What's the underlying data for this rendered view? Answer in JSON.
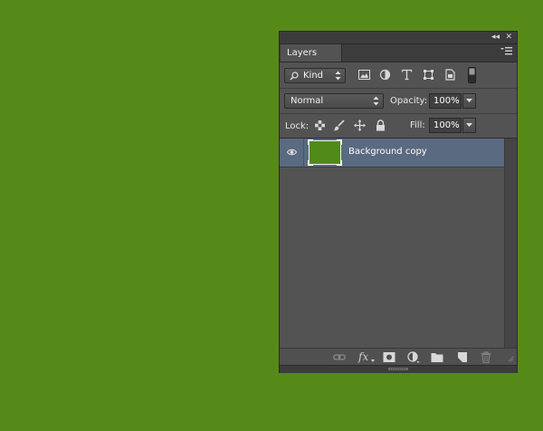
{
  "colors": {
    "canvas": "#568a18",
    "panel": "#535353",
    "selected_row": "#5a6a80",
    "thumbnail": "#518a18"
  },
  "panel": {
    "title_tab": "Layers",
    "topbar": {
      "collapse_glyph": "◂◂",
      "close_glyph": "✕"
    },
    "filter": {
      "search_icon": "search-icon",
      "kind_label": "Kind",
      "filter_icons": [
        "pixel-filter-icon",
        "adjustment-filter-icon",
        "type-filter-icon",
        "shape-filter-icon",
        "smart-object-filter-icon"
      ]
    },
    "blend": {
      "mode": "Normal",
      "opacity_label": "Opacity:",
      "opacity_value": "100%"
    },
    "lock": {
      "label": "Lock:",
      "icons": [
        "lock-transparent-icon",
        "lock-image-icon",
        "lock-position-icon",
        "lock-all-icon"
      ],
      "fill_label": "Fill:",
      "fill_value": "100%"
    },
    "layers": [
      {
        "name": "Background copy",
        "visible": true,
        "selected": true
      }
    ],
    "bottom_icons": [
      "link-icon",
      "fx-icon",
      "mask-icon",
      "adjustment-layer-icon",
      "folder-icon",
      "new-layer-icon",
      "trash-icon"
    ],
    "fx_label": "fx"
  }
}
